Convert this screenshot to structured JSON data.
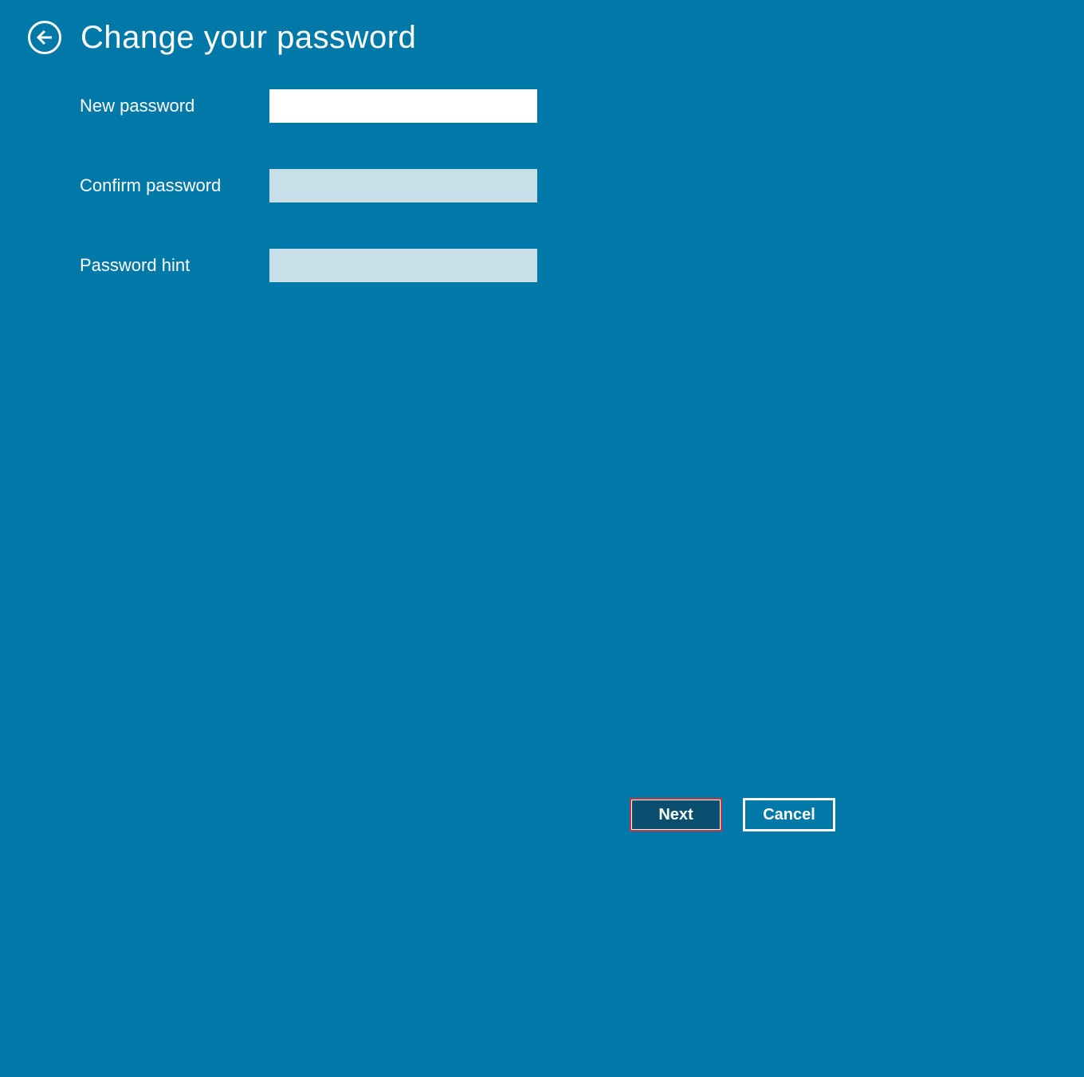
{
  "header": {
    "title": "Change your password"
  },
  "form": {
    "new_password": {
      "label": "New password",
      "value": ""
    },
    "confirm_password": {
      "label": "Confirm password",
      "value": ""
    },
    "password_hint": {
      "label": "Password hint",
      "value": ""
    }
  },
  "footer": {
    "next": "Next",
    "cancel": "Cancel"
  },
  "colors": {
    "background": "#0078a8",
    "active_input": "#ffffff",
    "inactive_input": "#c8dfe9",
    "primary_btn_bg": "#0a4f70",
    "primary_btn_border": "#d13438"
  }
}
